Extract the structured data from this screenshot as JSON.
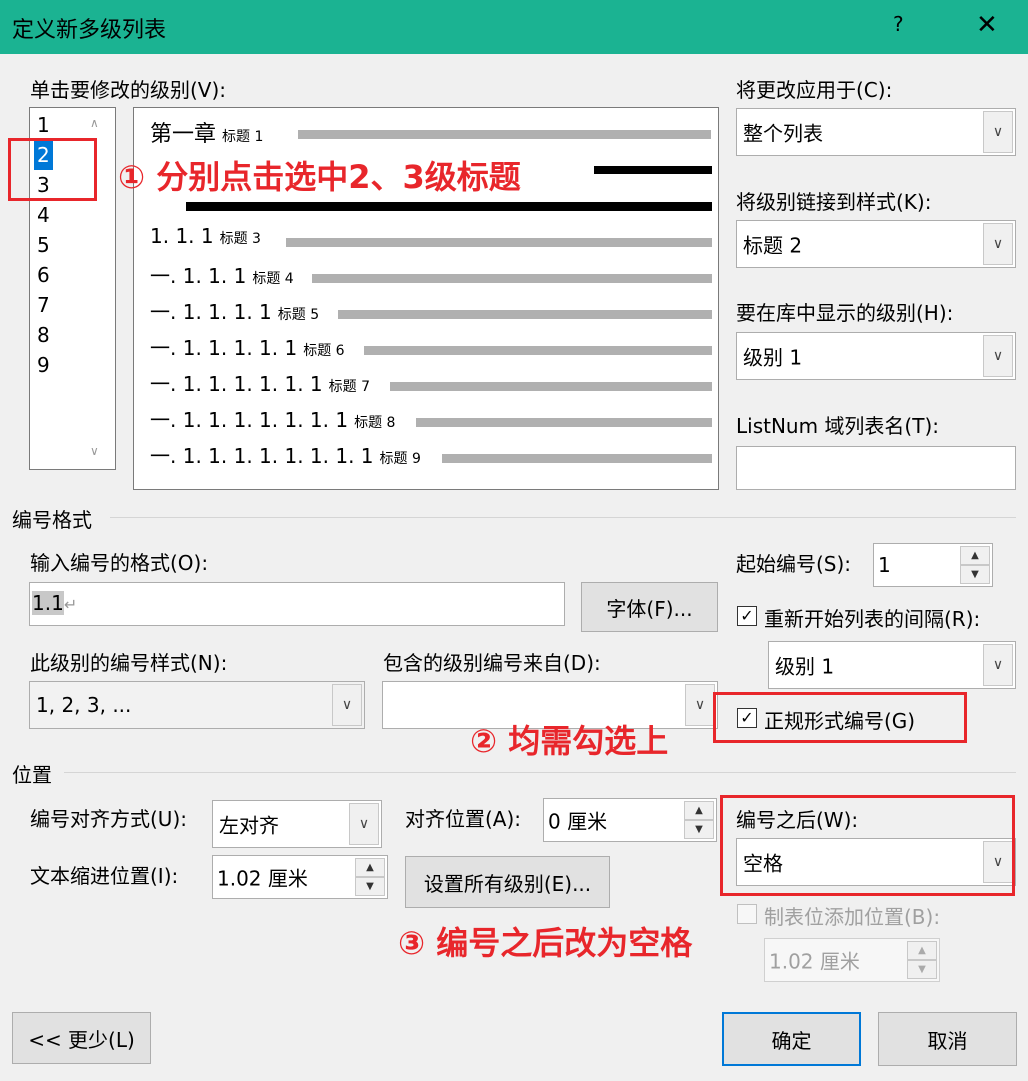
{
  "window": {
    "title": "定义新多级列表",
    "help": "?",
    "close": "✕"
  },
  "levels": {
    "label": "单击要修改的级别(V):",
    "items": [
      "1",
      "2",
      "3",
      "4",
      "5",
      "6",
      "7",
      "8",
      "9"
    ],
    "selected": "2"
  },
  "preview": {
    "rows": [
      {
        "num": "第一章",
        "style": "标题 1"
      },
      {
        "num": "1. 1. 1",
        "style": "标题 3"
      },
      {
        "num": "一. 1. 1. 1",
        "style": "标题 4"
      },
      {
        "num": "一. 1. 1. 1. 1",
        "style": "标题 5"
      },
      {
        "num": "一. 1. 1. 1. 1. 1",
        "style": "标题 6"
      },
      {
        "num": "一. 1. 1. 1. 1. 1. 1",
        "style": "标题 7"
      },
      {
        "num": "一. 1. 1. 1. 1. 1. 1. 1",
        "style": "标题 8"
      },
      {
        "num": "一. 1. 1. 1. 1. 1. 1. 1. 1",
        "style": "标题 9"
      }
    ]
  },
  "right_panel": {
    "apply_label": "将更改应用于(C):",
    "apply_value": "整个列表",
    "link_label": "将级别链接到样式(K):",
    "link_value": "标题 2",
    "gallery_label": "要在库中显示的级别(H):",
    "gallery_value": "级别 1",
    "listnum_label": "ListNum 域列表名(T):",
    "listnum_value": ""
  },
  "number_format": {
    "section": "编号格式",
    "format_label": "输入编号的格式(O):",
    "format_value": "1.1",
    "font_button": "字体(F)...",
    "style_label": "此级别的编号样式(N):",
    "style_value": "1, 2, 3, ...",
    "include_label": "包含的级别编号来自(D):",
    "include_value": "",
    "start_label": "起始编号(S):",
    "start_value": "1",
    "restart_label": "重新开始列表的间隔(R):",
    "restart_checked": true,
    "restart_value": "级别 1",
    "legal_label": "正规形式编号(G)",
    "legal_checked": true
  },
  "position": {
    "section": "位置",
    "align_label": "编号对齐方式(U):",
    "align_value": "左对齐",
    "at_label": "对齐位置(A):",
    "at_value": "0 厘米",
    "indent_label": "文本缩进位置(I):",
    "indent_value": "1.02 厘米",
    "set_all_button": "设置所有级别(E)...",
    "follow_label": "编号之后(W):",
    "follow_value": "空格",
    "tab_label": "制表位添加位置(B):",
    "tab_checked": false,
    "tab_value": "1.02 厘米"
  },
  "buttons": {
    "less": "<< 更少(L)",
    "ok": "确定",
    "cancel": "取消"
  },
  "annotations": {
    "a1": "① 分别点击选中2、3级标题",
    "a2": "② 均需勾选上",
    "a3": "③ 编号之后改为空格"
  },
  "colors": {
    "titlebar": "#1bb392",
    "annotation": "#e8262b",
    "selection": "#0078d7"
  }
}
